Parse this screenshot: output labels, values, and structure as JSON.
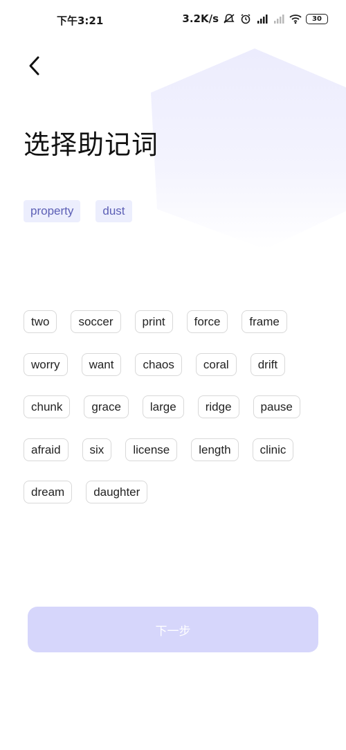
{
  "status_bar": {
    "time": "下午3:21",
    "net_speed": "3.2K/s",
    "battery": "30",
    "icons": [
      "mute-icon",
      "alarm-icon",
      "hd-signal-icon",
      "signal-icon",
      "wifi-icon",
      "battery-icon"
    ]
  },
  "header": {
    "back_icon": "chevron-left-icon",
    "title": "选择助记词"
  },
  "selected_words": [
    "property",
    "dust"
  ],
  "word_rows": [
    [
      "two",
      "soccer",
      "print",
      "force",
      "frame"
    ],
    [
      "worry",
      "want",
      "chaos",
      "coral",
      "drift"
    ],
    [
      "chunk",
      "grace",
      "large",
      "ridge",
      "pause"
    ],
    [
      "afraid",
      "six",
      "license",
      "length",
      "clinic"
    ],
    [
      "dream",
      "daughter"
    ]
  ],
  "footer": {
    "next_label": "下一步"
  },
  "colors": {
    "accent_light": "#d6d6fb",
    "chip_selected_bg": "#eceefd",
    "chip_selected_text": "#5c5fb5",
    "chip_border": "#d8d8d8"
  }
}
